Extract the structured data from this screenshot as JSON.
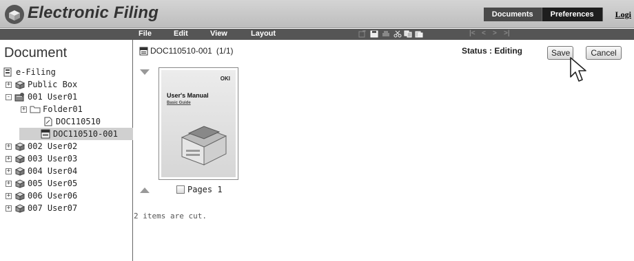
{
  "header": {
    "app_title": "Electronic Filing",
    "tabs": [
      {
        "label": "Documents",
        "active": false
      },
      {
        "label": "Preferences",
        "active": true
      }
    ],
    "login_label": "Logi"
  },
  "menubar": {
    "items": [
      "File",
      "Edit",
      "View",
      "Layout"
    ],
    "toolbar_icons": [
      "insert-page-icon",
      "save-icon",
      "print-icon",
      "cut-icon",
      "copy-icon",
      "paste-icon"
    ],
    "nav_icons": [
      "first-page-icon",
      "previous-page-icon",
      "next-page-icon",
      "last-page-icon"
    ]
  },
  "sidebar": {
    "title": "Document",
    "tree": [
      {
        "label": "e-Filing",
        "icon": "efiling-root-icon",
        "expander": ""
      },
      {
        "label": "Public Box",
        "icon": "public-box-icon",
        "expander": "+"
      },
      {
        "label": "001 User01",
        "icon": "user-box-icon",
        "expander": "-"
      },
      {
        "label": "Folder01",
        "icon": "folder-icon",
        "expander": "+"
      },
      {
        "label": "DOC110510",
        "icon": "document-icon",
        "expander": ""
      },
      {
        "label": "DOC110510-001",
        "icon": "document-editing-icon",
        "expander": "",
        "selected": true
      },
      {
        "label": "002 User02",
        "icon": "user-box-icon",
        "expander": "+"
      },
      {
        "label": "003 User03",
        "icon": "user-box-icon",
        "expander": "+"
      },
      {
        "label": "004 User04",
        "icon": "user-box-icon",
        "expander": "+"
      },
      {
        "label": "005 User05",
        "icon": "user-box-icon",
        "expander": "+"
      },
      {
        "label": "006 User06",
        "icon": "user-box-icon",
        "expander": "+"
      },
      {
        "label": "007 User07",
        "icon": "user-box-icon",
        "expander": "+"
      }
    ]
  },
  "content": {
    "document_title": "DOC110510-001",
    "page_count": "(1/1)",
    "status": "Status : Editing",
    "save_label": "Save",
    "cancel_label": "Cancel",
    "thumbnail": {
      "brand": "OKI",
      "title": "User's Manual",
      "subtitle": "Basic Guide"
    },
    "pages_label": "Pages 1",
    "message": "2 items are cut."
  },
  "colors": {
    "header_bg": "#c8c8c8",
    "menubar_bg": "#555555",
    "active_tab_bg": "#1e1e1e",
    "selected_row_bg": "#d0d0d0"
  }
}
